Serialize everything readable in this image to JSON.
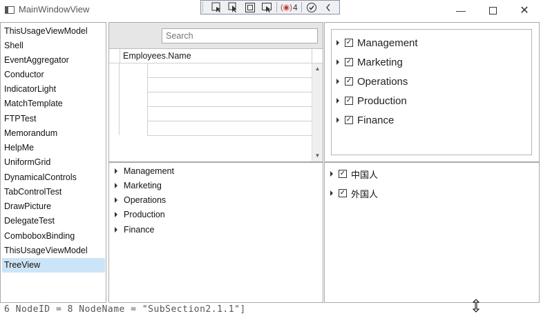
{
  "window": {
    "title": "MainWindowView"
  },
  "debug_toolbar": {
    "counter": "4",
    "items": [
      "select-element-icon",
      "pointer-icon",
      "box-icon",
      "layout-icon",
      "binding-icon",
      "check-icon",
      "collapse-icon"
    ]
  },
  "left_list": {
    "items": [
      "ThisUsageViewModel",
      "Shell",
      "EventAggregator",
      "Conductor",
      "IndicatorLight",
      "MatchTemplate",
      "FTPTest",
      "Memorandum",
      "HelpMe",
      "UniformGrid",
      "DynamicalControls",
      "TabControlTest",
      "DrawPicture",
      "DelegateTest",
      "ComboboxBinding",
      "ThisUsageViewModel",
      "TreeView"
    ],
    "selected": "TreeView"
  },
  "grid": {
    "search_placeholder": "Search",
    "column_header": "Employees.Name"
  },
  "checkbox_tree": {
    "items": [
      "Management",
      "Marketing",
      "Operations",
      "Production",
      "Finance"
    ]
  },
  "plain_tree": {
    "items": [
      "Management",
      "Marketing",
      "Operations",
      "Production",
      "Finance"
    ]
  },
  "people_tree": {
    "items": [
      "中国人",
      "外国人"
    ]
  },
  "background_text": "6 NodeID = 8 NodeName = \"SubSection2.1.1\"]"
}
